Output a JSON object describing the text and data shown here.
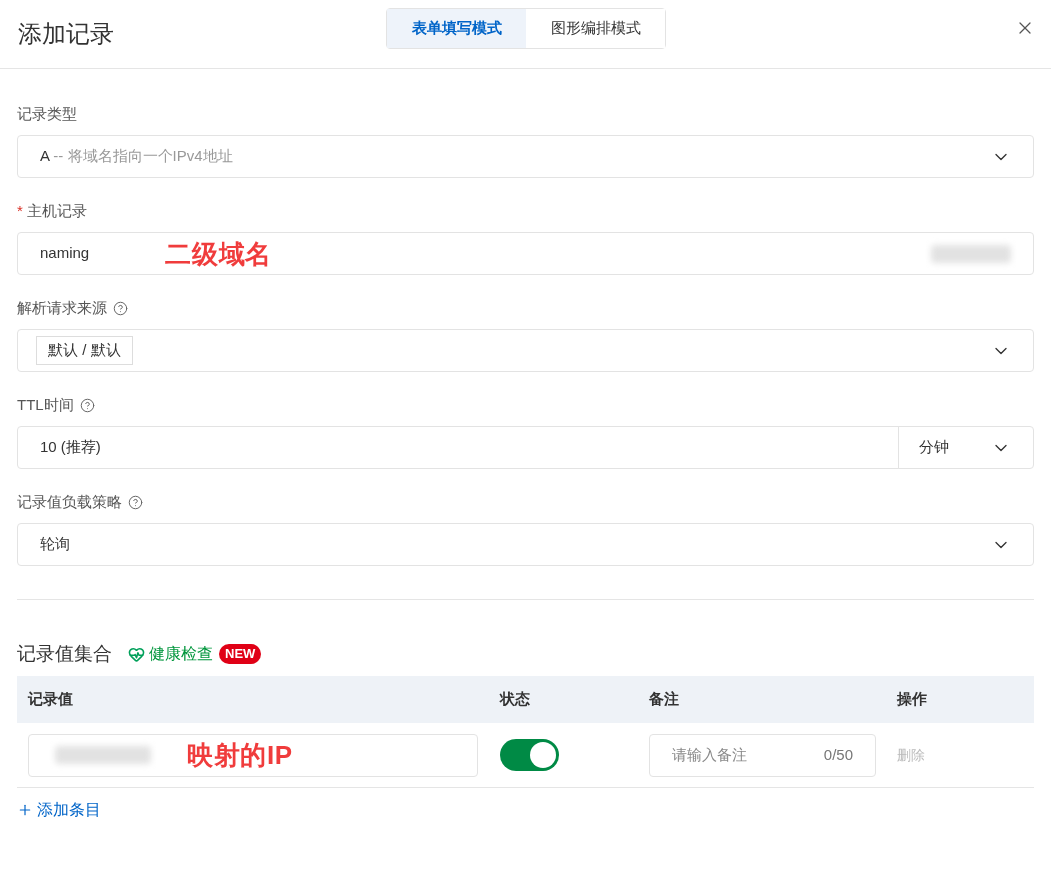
{
  "dialog": {
    "title": "添加记录"
  },
  "tabs": [
    {
      "label": "表单填写模式",
      "selected": true
    },
    {
      "label": "图形编排模式",
      "selected": false
    }
  ],
  "fields": [
    {
      "kind": "select",
      "label": "记录类型",
      "help": false,
      "value": "A",
      "hint": "-- 将域名指向一个IPv4地址"
    },
    {
      "kind": "input",
      "required_mark": "*",
      "label": "主机记录",
      "help": false,
      "value": "naming",
      "annotation": "二级域名",
      "blurred": true
    },
    {
      "kind": "tag-select",
      "label": "解析请求来源",
      "help": true,
      "value": "默认 / 默认"
    },
    {
      "kind": "unit-input",
      "label": "TTL时间",
      "help": true,
      "value": "10 (推荐)",
      "unit": "分钟"
    },
    {
      "kind": "select",
      "label": "记录值负载策略",
      "help": true,
      "value": "轮询"
    }
  ],
  "records": {
    "title": "记录值集合",
    "health_check": "健康检查",
    "badge": "NEW",
    "columns": [
      "记录值",
      "状态",
      "备注",
      "操作"
    ],
    "rows": [
      {
        "annotation": "映射的IP",
        "on": true,
        "note_placeholder": "请输入备注",
        "note_count": "0/50",
        "action": "删除"
      }
    ],
    "add_label": "添加条目"
  }
}
